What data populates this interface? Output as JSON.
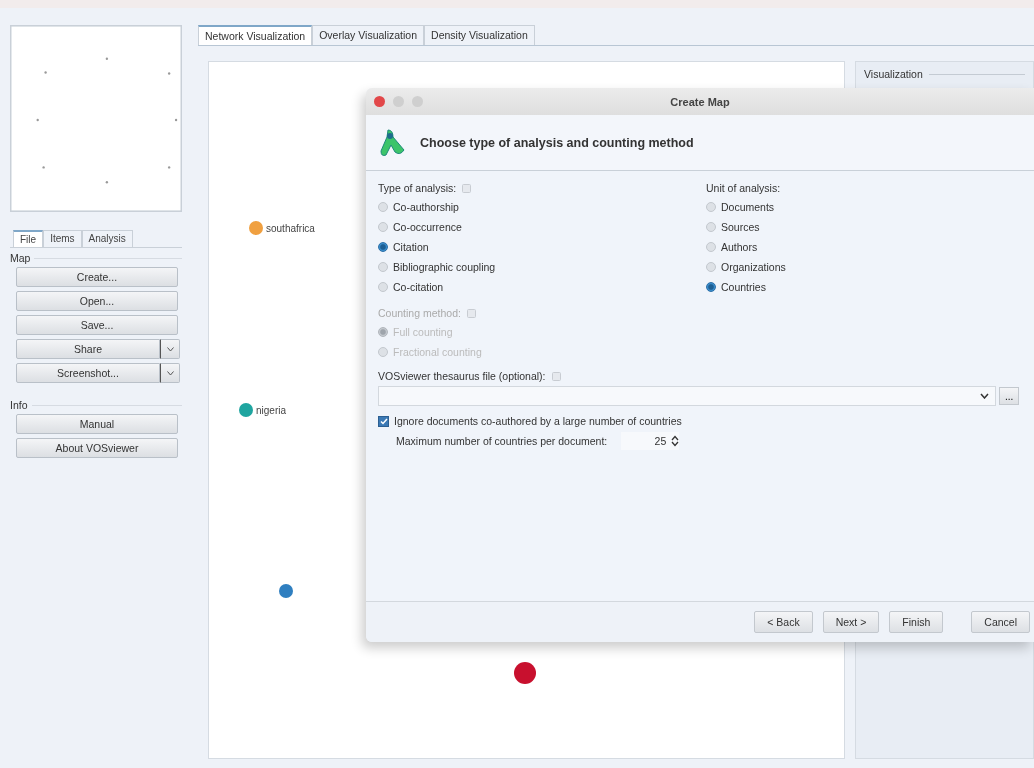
{
  "sidebar": {
    "tabs": [
      {
        "label": "File",
        "selected": true
      },
      {
        "label": "Items",
        "selected": false
      },
      {
        "label": "Analysis",
        "selected": false
      }
    ],
    "sections": [
      {
        "title": "Map",
        "buttons": [
          {
            "label": "Create...",
            "kind": "plain"
          },
          {
            "label": "Open...",
            "kind": "plain"
          },
          {
            "label": "Save...",
            "kind": "plain"
          },
          {
            "label": "Share",
            "kind": "split"
          },
          {
            "label": "Screenshot...",
            "kind": "split"
          }
        ]
      },
      {
        "title": "Info",
        "buttons": [
          {
            "label": "Manual",
            "kind": "plain"
          },
          {
            "label": "About VOSviewer",
            "kind": "plain"
          }
        ]
      }
    ]
  },
  "view_tabs": [
    {
      "label": "Network Visualization",
      "selected": true
    },
    {
      "label": "Overlay Visualization",
      "selected": false
    },
    {
      "label": "Density Visualization",
      "selected": false
    }
  ],
  "network_nodes": [
    {
      "label": "southafrica",
      "color": "#f0a040"
    },
    {
      "label": "nigeria",
      "color": "#1fa5a0"
    },
    {
      "color": "#2f7fc0"
    },
    {
      "color": "#c8102e"
    }
  ],
  "right_panel": {
    "title": "Visualization"
  },
  "dialog": {
    "title": "Create Map",
    "heading": "Choose type of analysis and counting method",
    "type_of_analysis": {
      "label": "Type of analysis:",
      "options": [
        {
          "label": "Co-authorship",
          "selected": false
        },
        {
          "label": "Co-occurrence",
          "selected": false
        },
        {
          "label": "Citation",
          "selected": true
        },
        {
          "label": "Bibliographic coupling",
          "selected": false
        },
        {
          "label": "Co-citation",
          "selected": false
        }
      ]
    },
    "unit_of_analysis": {
      "label": "Unit of analysis:",
      "options": [
        {
          "label": "Documents",
          "selected": false
        },
        {
          "label": "Sources",
          "selected": false
        },
        {
          "label": "Authors",
          "selected": false
        },
        {
          "label": "Organizations",
          "selected": false
        },
        {
          "label": "Countries",
          "selected": true
        }
      ]
    },
    "counting_method": {
      "label": "Counting method:",
      "disabled": true,
      "options": [
        {
          "label": "Full counting",
          "selected": true
        },
        {
          "label": "Fractional counting",
          "selected": false
        }
      ]
    },
    "thesaurus": {
      "label": "VOSviewer thesaurus file (optional):",
      "browse": "..."
    },
    "ignore_option": {
      "label": "Ignore documents co-authored by a large number of countries",
      "checked": true
    },
    "max_countries": {
      "label": "Maximum number of countries per document:",
      "value": "25"
    },
    "buttons": [
      {
        "label": "< Back",
        "kind": "nav"
      },
      {
        "label": "Next >",
        "kind": "nav"
      },
      {
        "label": "Finish",
        "kind": "nav"
      },
      {
        "label": "Cancel",
        "kind": "cancel"
      }
    ]
  }
}
